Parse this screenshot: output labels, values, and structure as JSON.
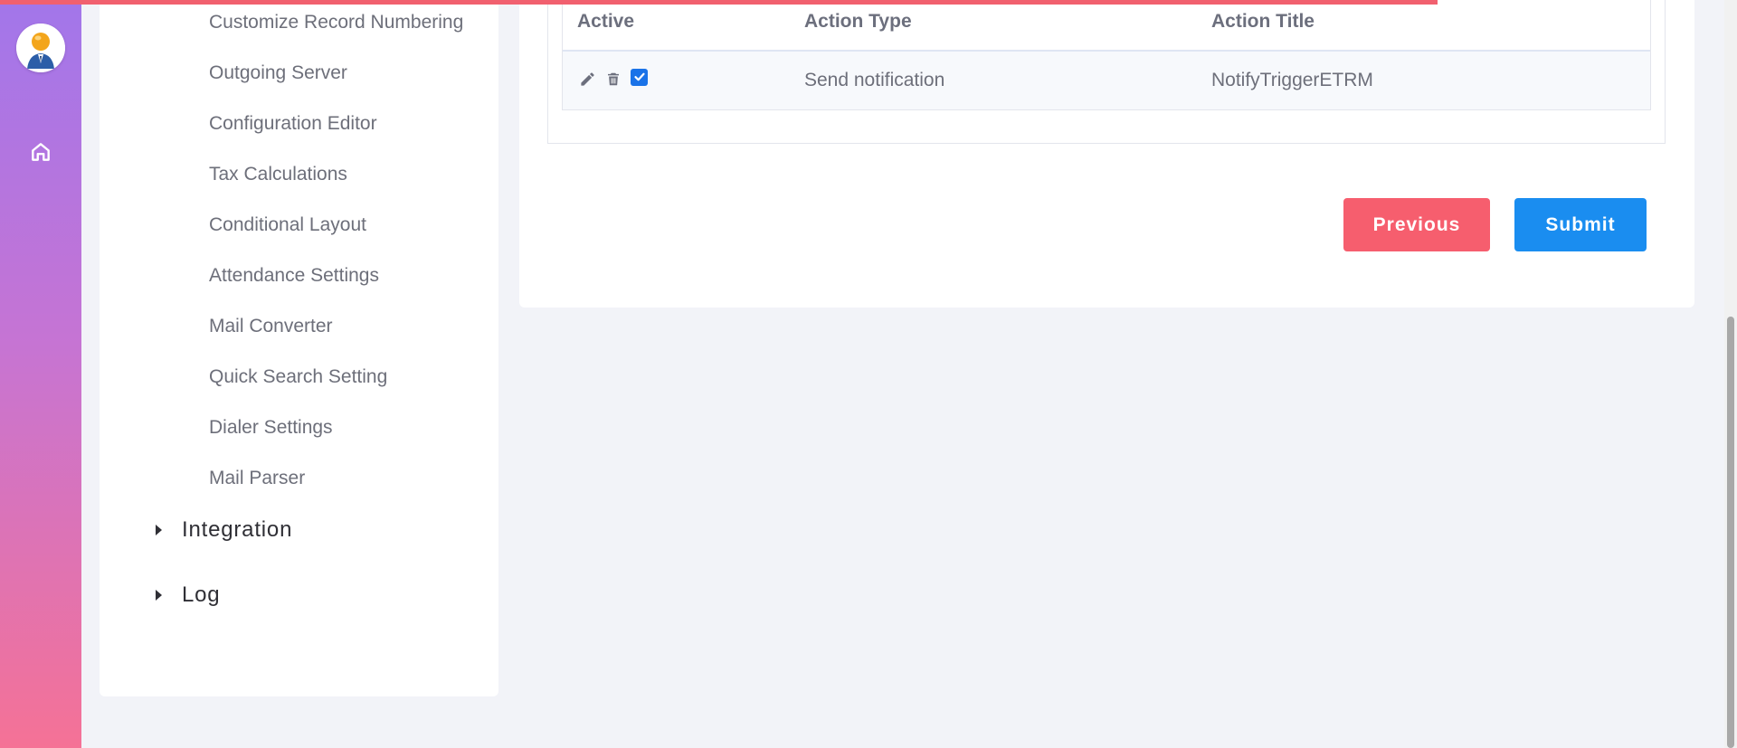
{
  "colors": {
    "progress": "#f1606f",
    "rail_top": "#a276ea",
    "rail_bottom": "#f57296",
    "previous_button": "#f65e6e",
    "submit_button": "#1a8df0",
    "checkbox": "#1a73e8"
  },
  "rail": {
    "avatar_icon": "user-avatar-icon",
    "home_icon": "home-icon"
  },
  "settings_menu": {
    "items": [
      {
        "label": "Customize Record Numbering"
      },
      {
        "label": "Outgoing Server"
      },
      {
        "label": "Configuration Editor"
      },
      {
        "label": "Tax Calculations"
      },
      {
        "label": "Conditional Layout"
      },
      {
        "label": "Attendance Settings"
      },
      {
        "label": "Mail Converter"
      },
      {
        "label": "Quick Search Setting"
      },
      {
        "label": "Dialer Settings"
      },
      {
        "label": "Mail Parser"
      }
    ],
    "sections": [
      {
        "label": "Integration",
        "icon": "caret-right-icon"
      },
      {
        "label": "Log",
        "icon": "caret-right-icon"
      }
    ]
  },
  "actions_table": {
    "columns": [
      "Active",
      "Action Type",
      "Action Title"
    ],
    "rows": [
      {
        "edit_icon": "pencil-icon",
        "delete_icon": "trash-icon",
        "active": true,
        "action_type": "Send notification",
        "action_title": "NotifyTriggerETRM"
      }
    ]
  },
  "buttons": {
    "previous": "Previous",
    "submit": "Submit"
  }
}
